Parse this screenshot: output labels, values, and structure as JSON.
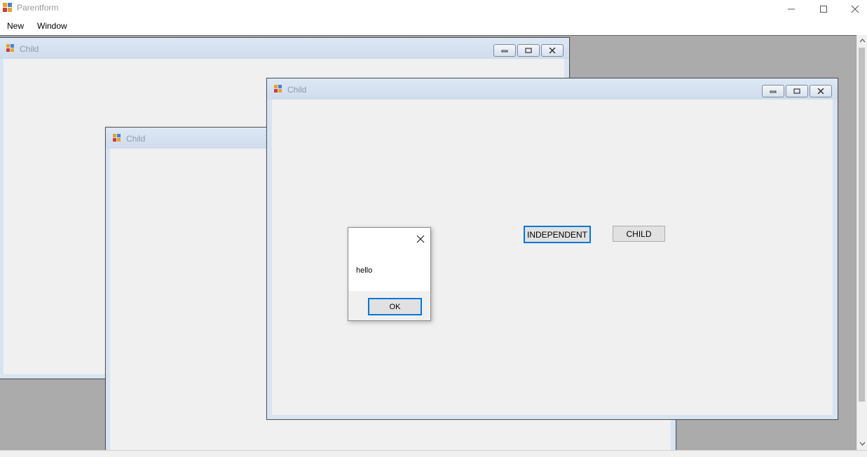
{
  "app": {
    "title": "Parentform"
  },
  "menu": {
    "items": [
      {
        "label": "New"
      },
      {
        "label": "Window"
      }
    ]
  },
  "children": [
    {
      "title": "Child"
    },
    {
      "title": "Child"
    },
    {
      "title": "Child"
    }
  ],
  "active_child": {
    "buttons": {
      "independent": "INDEPENDENT",
      "child": "CHILD"
    }
  },
  "message_box": {
    "message": "hello",
    "ok_label": "OK"
  },
  "colors": {
    "mdi_background": "#ababab",
    "focus_border": "#0078d7",
    "caption": "#d8e4f2"
  },
  "icons": [
    "app-icon",
    "minimize-icon",
    "maximize-icon",
    "close-icon",
    "mdi-restore-icon"
  ]
}
